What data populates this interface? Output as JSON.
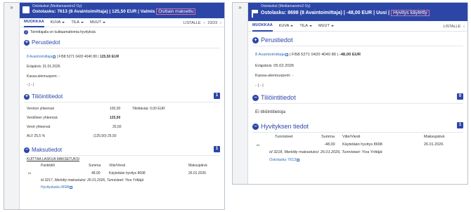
{
  "left": {
    "subtitle": "Ostolaskut (Mediamaestro2 Oy)",
    "title": "Ostolasku: 7613 (8 Avaintoimittaja) | 125,50 EUR | Valmis",
    "status": "Osittain maksettu",
    "tabs": [
      "MUOKKAA",
      "KUVA",
      "TILA",
      "MUUT"
    ],
    "lists_label": "LISTALLE",
    "pager": "23/23",
    "notice": "Toimittajalla on kuittaamattomia hyvityksiä",
    "sections": {
      "perustiedot": "Perustiedot",
      "tiliointitiedot": "Tiliöintitiedot",
      "tiliointi_count": "1",
      "maksutiedot": "Maksutiedot",
      "maksutiedot_count": "1"
    },
    "supplier_link": "8 Avaintoimittaja",
    "iban": "FI58 5271 0420 4040 80",
    "amount": "125,50 EUR",
    "due_label": "Eräpäivä:",
    "due_value": "31.01.2026",
    "discount_label": "Kassa-alennuspvm: -",
    "dashes": "- | - |",
    "accounting": {
      "net_label": "Veroton yhteensä",
      "net_value": "100,00",
      "tax_label": "Verollinen yhteensä",
      "tax_value": "125,50",
      "vat_label": "Verot yhteensä",
      "vat_value": "25,50",
      "rate_label": "ALV 25,5 %",
      "rate_value": "(125,50) 25,50",
      "tili_label": "Tiliöitävää: 0,00 EUR"
    },
    "kuittaa_link": "KUITTAA LASKUA MAKSETUKSI",
    "pay_headers": [
      "Pankkitili",
      "Summa",
      "Viite/Viesti",
      "Maksupäivä"
    ],
    "pay_row": {
      "idx": "#1",
      "sum": "48,00",
      "ref": "Käytetään hyvitys 8698",
      "date": "26.01.2026"
    },
    "pay_meta": "Id 3217, Merkitty maksetuksi: 26.01.2026, Tunnisteet: Yiva Yrittäjä",
    "pay_link": "Hyvityslasku 8698"
  },
  "right": {
    "subtitle": "Ostolaskut (Mediamaestro2 Oy)",
    "title": "Ostolasku: 8698 (8 Avaintoimittaja) | -48,00 EUR | Uusi |",
    "status": "Hyvitys käytetty",
    "tabs": [
      "MUOKKAA",
      "KUVA",
      "TILA",
      "MUUT"
    ],
    "lists_label": "LISTALLE",
    "sections": {
      "perustiedot": "Perustiedot",
      "tiliointitiedot": "Tiliöintitiedot",
      "tiliointi_count": "0",
      "hyvitys": "Hyvityksen tiedot",
      "hyvitys_count": "1"
    },
    "supplier_link": "8 Avaintoimittaja",
    "iban": "FI58 5271 0420 4040 80",
    "amount": "-48,00 EUR",
    "due_label": "Eräpäivä:",
    "due_value": "05.02.2026",
    "discount_label": "Kassa-alennuspvm: -",
    "dashes": "- | - |",
    "no_tiliointi": "Ei tiliöintitietoja",
    "cred_headers": [
      "Tunnisteet",
      "Summa",
      "Viite/Viesti",
      "Maksupäivä"
    ],
    "cred_row": {
      "idx": "#1",
      "sum": "-48,00",
      "ref": "Käytetään hyvitys 8698",
      "date": "26.01.2026"
    },
    "cred_meta": "Id 3218, Merkitty maksetuksi: 26.01.2026, Tunnisteet: Yiva Yrittäjä",
    "cred_link": "Ostolasku 7613"
  }
}
